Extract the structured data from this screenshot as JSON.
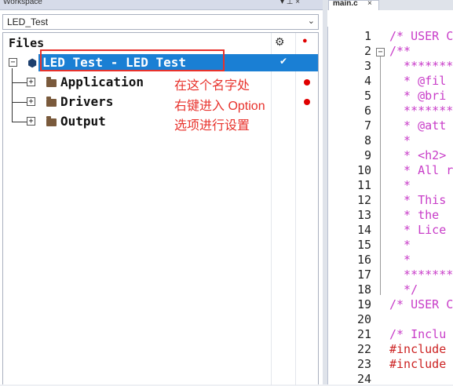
{
  "workspace": {
    "title": "Workspace",
    "pin_glyph": "▾ ⊥ ×",
    "combo_value": "LED_Test",
    "combo_arrow": "⌄",
    "files_header": "Files",
    "gear_glyph": "⚙",
    "dot_glyph": "●",
    "rows": [
      {
        "label": "LED Test - LED Test",
        "toggle": "−",
        "selected": true,
        "check": "✔"
      },
      {
        "label": "Application",
        "toggle": "+"
      },
      {
        "label": "Drivers",
        "toggle": "+"
      },
      {
        "label": "Output",
        "toggle": "+"
      }
    ],
    "annotation_lines": [
      "在这个名字处",
      "右键进入 Option",
      "选项进行设置"
    ]
  },
  "editor": {
    "tab_label": "main.c",
    "tab_close": "×",
    "fold_collapse": "−",
    "colors": {
      "comment": "#c83cc8",
      "directive": "#cc2222",
      "accent": "#1a7fd4"
    },
    "lines": [
      {
        "n": "1",
        "text": "/* USER C"
      },
      {
        "n": "2",
        "text": "/**"
      },
      {
        "n": "3",
        "text": "  *******"
      },
      {
        "n": "4",
        "text": "  * @fil"
      },
      {
        "n": "5",
        "text": "  * @bri"
      },
      {
        "n": "6",
        "text": "  *******"
      },
      {
        "n": "7",
        "text": "  * @att"
      },
      {
        "n": "8",
        "text": "  *"
      },
      {
        "n": "9",
        "text": "  * <h2>"
      },
      {
        "n": "10",
        "text": "  * All r"
      },
      {
        "n": "11",
        "text": "  *"
      },
      {
        "n": "12",
        "text": "  * This"
      },
      {
        "n": "13",
        "text": "  * the "
      },
      {
        "n": "14",
        "text": "  * Lice"
      },
      {
        "n": "15",
        "text": "  *"
      },
      {
        "n": "16",
        "text": "  *"
      },
      {
        "n": "17",
        "text": "  *******"
      },
      {
        "n": "18",
        "text": "  */"
      },
      {
        "n": "19",
        "text": "/* USER C"
      },
      {
        "n": "20",
        "text": ""
      },
      {
        "n": "21",
        "text": "/* Inclu"
      },
      {
        "n": "22",
        "text": "#include"
      },
      {
        "n": "23",
        "text": "#include"
      },
      {
        "n": "24",
        "text": ""
      }
    ]
  }
}
